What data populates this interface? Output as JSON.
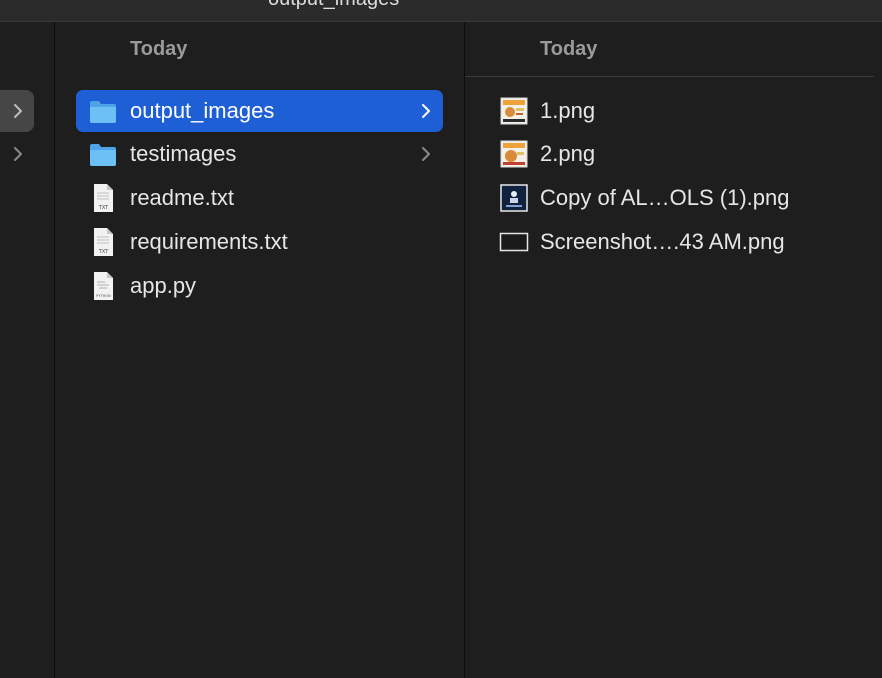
{
  "window": {
    "title": "output_images"
  },
  "columns": {
    "middle": {
      "header": "Today",
      "items": [
        {
          "label": "output_images",
          "kind": "folder",
          "selected": true
        },
        {
          "label": "testimages",
          "kind": "folder",
          "selected": false
        },
        {
          "label": "readme.txt",
          "kind": "txt",
          "badge": "TXT"
        },
        {
          "label": "requirements.txt",
          "kind": "txt",
          "badge": "TXT"
        },
        {
          "label": "app.py",
          "kind": "python",
          "badge": "PYTHON"
        }
      ]
    },
    "right": {
      "header": "Today",
      "items": [
        {
          "label": "1.png",
          "kind": "image-thumb"
        },
        {
          "label": "2.png",
          "kind": "image-thumb"
        },
        {
          "label": "Copy of AL…OLS (1).png",
          "kind": "image-thumb-blue"
        },
        {
          "label": "Screenshot….43 AM.png",
          "kind": "image-thumb-dark"
        }
      ]
    }
  },
  "icons": {
    "folder": "folder-icon",
    "txt": "text-file-icon",
    "python": "python-file-icon",
    "chevron": "chevron-right-icon"
  },
  "colors": {
    "background": "#1e1e1e",
    "selection": "#1f5fd6",
    "folder": "#5ab2f0",
    "header_text": "#9a9a9a"
  }
}
